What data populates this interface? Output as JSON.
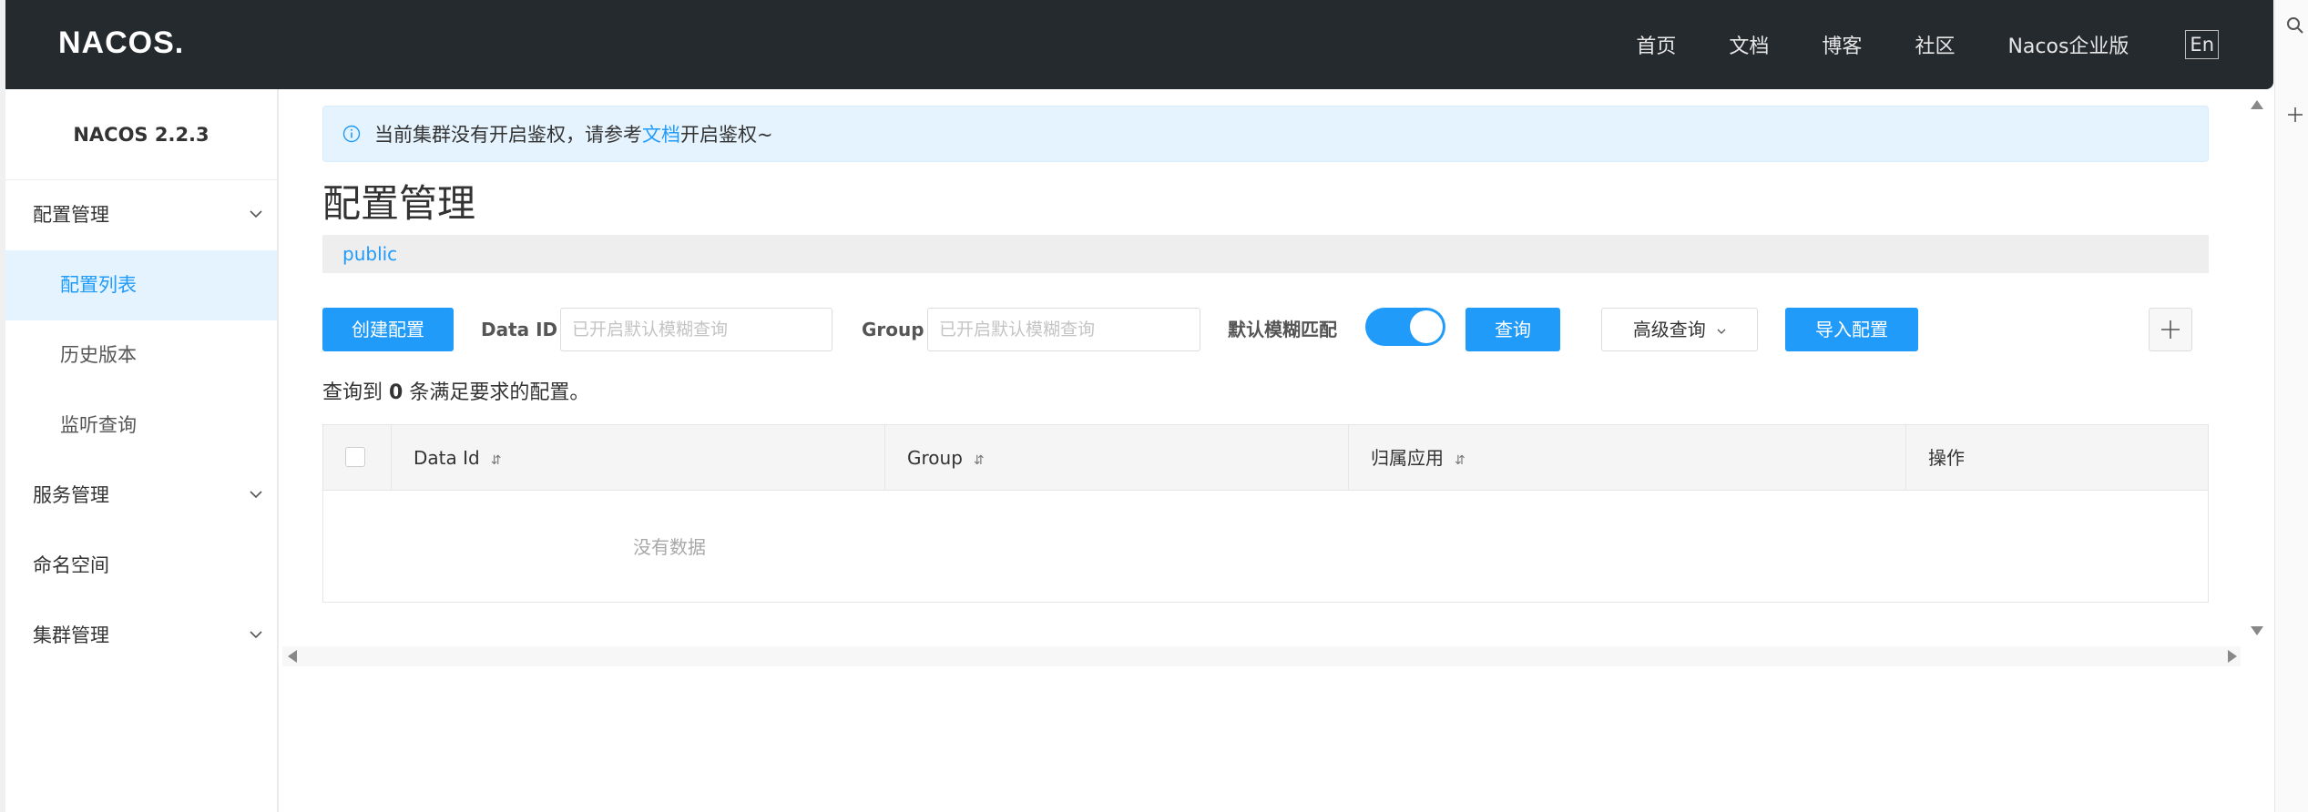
{
  "header": {
    "logo": "NACOS.",
    "nav": [
      "首页",
      "文档",
      "博客",
      "社区",
      "Nacos企业版"
    ],
    "lang": "En"
  },
  "sidebar": {
    "version": "NACOS 2.2.3",
    "groups": [
      {
        "label": "配置管理",
        "expanded": true,
        "items": [
          {
            "label": "配置列表",
            "active": true
          },
          {
            "label": "历史版本"
          },
          {
            "label": "监听查询"
          }
        ]
      },
      {
        "label": "服务管理"
      },
      {
        "label": "命名空间"
      },
      {
        "label": "集群管理"
      }
    ]
  },
  "alert": {
    "text_before": "当前集群没有开启鉴权，请参考",
    "link": "文档",
    "text_after": "开启鉴权~"
  },
  "page_title": "配置管理",
  "namespace": "public",
  "toolbar": {
    "create_button": "创建配置",
    "data_id_label": "Data ID",
    "data_id_placeholder": "已开启默认模糊查询",
    "group_label": "Group",
    "group_placeholder": "已开启默认模糊查询",
    "fuzzy_label": "默认模糊匹配",
    "fuzzy_on": true,
    "query_button": "查询",
    "advanced_button": "高级查询",
    "import_button": "导入配置"
  },
  "result": {
    "prefix": "查询到",
    "count": "0",
    "suffix": "条满足要求的配置。"
  },
  "table": {
    "columns": [
      "Data Id",
      "Group",
      "归属应用",
      "操作"
    ],
    "empty_text": "没有数据"
  },
  "colors": {
    "primary": "#209bfa",
    "header_bg": "#252a2f"
  }
}
